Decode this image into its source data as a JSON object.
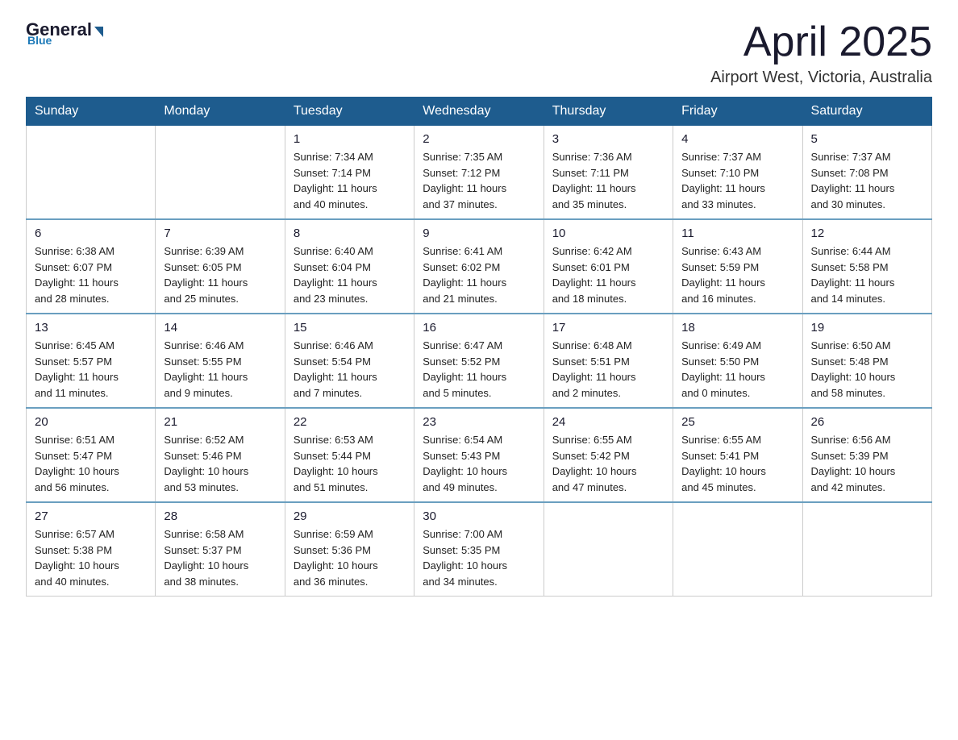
{
  "header": {
    "logo_general": "General",
    "logo_blue": "Blue",
    "month_title": "April 2025",
    "location": "Airport West, Victoria, Australia"
  },
  "weekdays": [
    "Sunday",
    "Monday",
    "Tuesday",
    "Wednesday",
    "Thursday",
    "Friday",
    "Saturday"
  ],
  "weeks": [
    [
      {
        "day": "",
        "info": ""
      },
      {
        "day": "",
        "info": ""
      },
      {
        "day": "1",
        "info": "Sunrise: 7:34 AM\nSunset: 7:14 PM\nDaylight: 11 hours\nand 40 minutes."
      },
      {
        "day": "2",
        "info": "Sunrise: 7:35 AM\nSunset: 7:12 PM\nDaylight: 11 hours\nand 37 minutes."
      },
      {
        "day": "3",
        "info": "Sunrise: 7:36 AM\nSunset: 7:11 PM\nDaylight: 11 hours\nand 35 minutes."
      },
      {
        "day": "4",
        "info": "Sunrise: 7:37 AM\nSunset: 7:10 PM\nDaylight: 11 hours\nand 33 minutes."
      },
      {
        "day": "5",
        "info": "Sunrise: 7:37 AM\nSunset: 7:08 PM\nDaylight: 11 hours\nand 30 minutes."
      }
    ],
    [
      {
        "day": "6",
        "info": "Sunrise: 6:38 AM\nSunset: 6:07 PM\nDaylight: 11 hours\nand 28 minutes."
      },
      {
        "day": "7",
        "info": "Sunrise: 6:39 AM\nSunset: 6:05 PM\nDaylight: 11 hours\nand 25 minutes."
      },
      {
        "day": "8",
        "info": "Sunrise: 6:40 AM\nSunset: 6:04 PM\nDaylight: 11 hours\nand 23 minutes."
      },
      {
        "day": "9",
        "info": "Sunrise: 6:41 AM\nSunset: 6:02 PM\nDaylight: 11 hours\nand 21 minutes."
      },
      {
        "day": "10",
        "info": "Sunrise: 6:42 AM\nSunset: 6:01 PM\nDaylight: 11 hours\nand 18 minutes."
      },
      {
        "day": "11",
        "info": "Sunrise: 6:43 AM\nSunset: 5:59 PM\nDaylight: 11 hours\nand 16 minutes."
      },
      {
        "day": "12",
        "info": "Sunrise: 6:44 AM\nSunset: 5:58 PM\nDaylight: 11 hours\nand 14 minutes."
      }
    ],
    [
      {
        "day": "13",
        "info": "Sunrise: 6:45 AM\nSunset: 5:57 PM\nDaylight: 11 hours\nand 11 minutes."
      },
      {
        "day": "14",
        "info": "Sunrise: 6:46 AM\nSunset: 5:55 PM\nDaylight: 11 hours\nand 9 minutes."
      },
      {
        "day": "15",
        "info": "Sunrise: 6:46 AM\nSunset: 5:54 PM\nDaylight: 11 hours\nand 7 minutes."
      },
      {
        "day": "16",
        "info": "Sunrise: 6:47 AM\nSunset: 5:52 PM\nDaylight: 11 hours\nand 5 minutes."
      },
      {
        "day": "17",
        "info": "Sunrise: 6:48 AM\nSunset: 5:51 PM\nDaylight: 11 hours\nand 2 minutes."
      },
      {
        "day": "18",
        "info": "Sunrise: 6:49 AM\nSunset: 5:50 PM\nDaylight: 11 hours\nand 0 minutes."
      },
      {
        "day": "19",
        "info": "Sunrise: 6:50 AM\nSunset: 5:48 PM\nDaylight: 10 hours\nand 58 minutes."
      }
    ],
    [
      {
        "day": "20",
        "info": "Sunrise: 6:51 AM\nSunset: 5:47 PM\nDaylight: 10 hours\nand 56 minutes."
      },
      {
        "day": "21",
        "info": "Sunrise: 6:52 AM\nSunset: 5:46 PM\nDaylight: 10 hours\nand 53 minutes."
      },
      {
        "day": "22",
        "info": "Sunrise: 6:53 AM\nSunset: 5:44 PM\nDaylight: 10 hours\nand 51 minutes."
      },
      {
        "day": "23",
        "info": "Sunrise: 6:54 AM\nSunset: 5:43 PM\nDaylight: 10 hours\nand 49 minutes."
      },
      {
        "day": "24",
        "info": "Sunrise: 6:55 AM\nSunset: 5:42 PM\nDaylight: 10 hours\nand 47 minutes."
      },
      {
        "day": "25",
        "info": "Sunrise: 6:55 AM\nSunset: 5:41 PM\nDaylight: 10 hours\nand 45 minutes."
      },
      {
        "day": "26",
        "info": "Sunrise: 6:56 AM\nSunset: 5:39 PM\nDaylight: 10 hours\nand 42 minutes."
      }
    ],
    [
      {
        "day": "27",
        "info": "Sunrise: 6:57 AM\nSunset: 5:38 PM\nDaylight: 10 hours\nand 40 minutes."
      },
      {
        "day": "28",
        "info": "Sunrise: 6:58 AM\nSunset: 5:37 PM\nDaylight: 10 hours\nand 38 minutes."
      },
      {
        "day": "29",
        "info": "Sunrise: 6:59 AM\nSunset: 5:36 PM\nDaylight: 10 hours\nand 36 minutes."
      },
      {
        "day": "30",
        "info": "Sunrise: 7:00 AM\nSunset: 5:35 PM\nDaylight: 10 hours\nand 34 minutes."
      },
      {
        "day": "",
        "info": ""
      },
      {
        "day": "",
        "info": ""
      },
      {
        "day": "",
        "info": ""
      }
    ]
  ]
}
